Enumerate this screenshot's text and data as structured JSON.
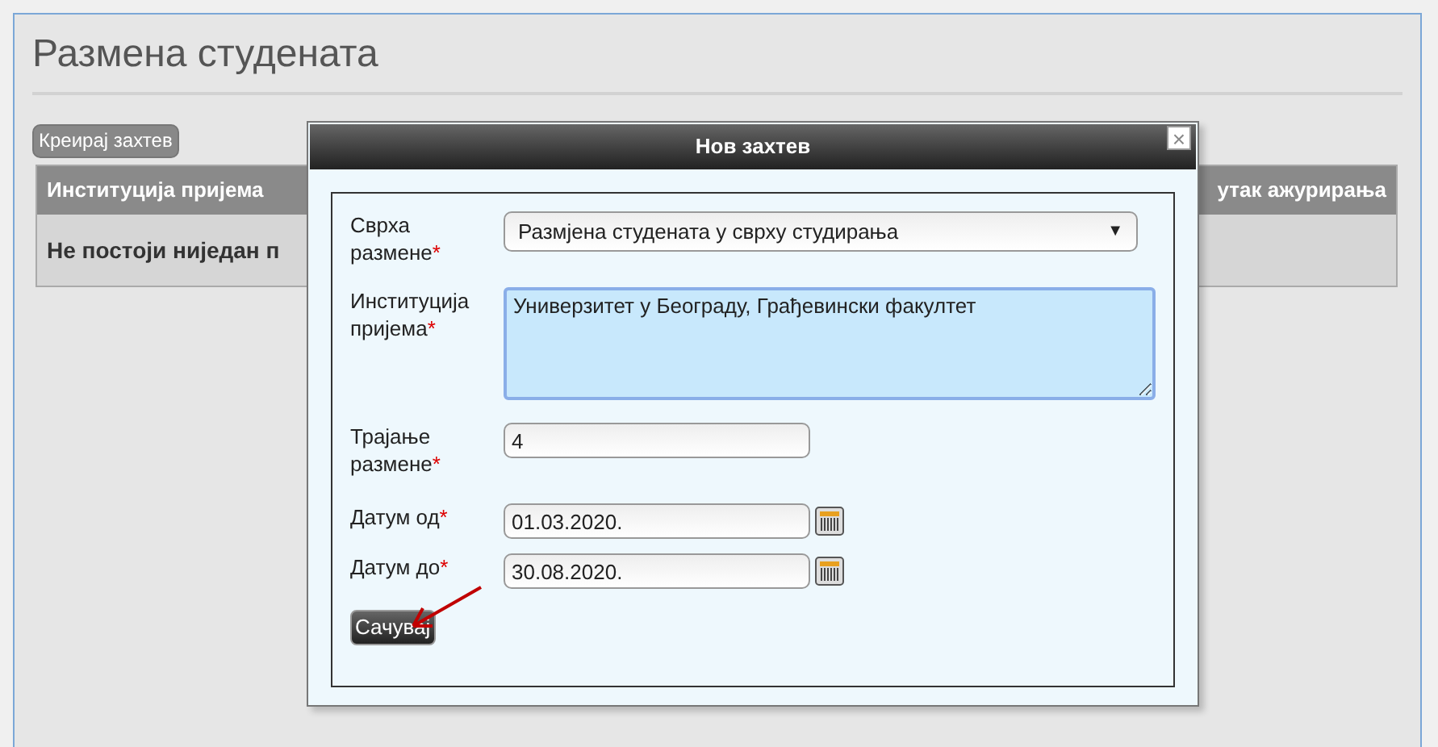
{
  "page": {
    "title": "Размена студената",
    "create_button": "Креирај захтев"
  },
  "table": {
    "columns": [
      {
        "label": "Институција пријема"
      },
      {
        "label": "утак ажурирања"
      }
    ],
    "empty_message": "Не постоји ниједан п"
  },
  "dialog": {
    "title": "Нов захтев",
    "close": "×",
    "fields": [
      {
        "kind": "select",
        "label": "Сврха размене",
        "required_mark": "*",
        "value": "Размјена студената у сврху студирања",
        "dropdown_arrow": "▼"
      },
      {
        "kind": "textarea",
        "label": "Институција пријема",
        "required_mark": "*",
        "value": "Универзитет у Београду, Грађевински факултет"
      },
      {
        "kind": "text",
        "label": "Трајање размене",
        "required_mark": "*",
        "value": "4"
      },
      {
        "kind": "date",
        "label": "Датум од",
        "required_mark": "*",
        "value": "01.03.2020."
      },
      {
        "kind": "date",
        "label": "Датум до",
        "required_mark": "*",
        "value": "30.08.2020."
      }
    ],
    "save_button": "Сачувај"
  }
}
